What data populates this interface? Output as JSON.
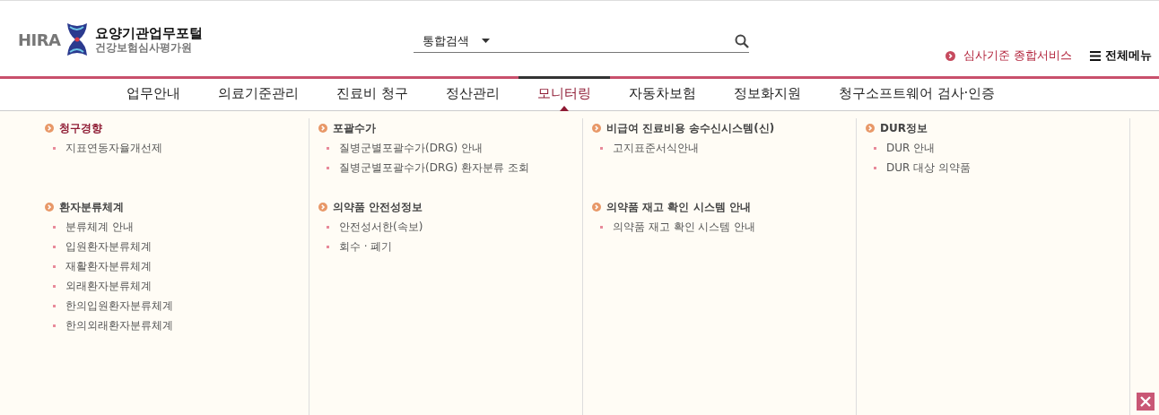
{
  "logo": {
    "mark": "HIRA",
    "title": "요양기관업무포털",
    "subtitle": "건강보험심사평가원"
  },
  "search": {
    "scope": "통합검색"
  },
  "links": [
    {
      "kind": "service",
      "label": "심사기준 종합서비스"
    },
    {
      "kind": "menu",
      "label": "전체메뉴"
    }
  ],
  "nav": [
    {
      "label": "업무안내",
      "selected": false
    },
    {
      "label": "의료기준관리",
      "selected": false
    },
    {
      "label": "진료비 청구",
      "selected": false
    },
    {
      "label": "정산관리",
      "selected": false
    },
    {
      "label": "모니터링",
      "selected": true
    },
    {
      "label": "자동차보험",
      "selected": false
    },
    {
      "label": "정보화지원",
      "selected": false
    },
    {
      "label": "청구소프트웨어 검사·인증",
      "selected": false
    }
  ],
  "columns": [
    {
      "sections": [
        {
          "title": "청구경향",
          "selected": true,
          "items": [
            "지표연동자율개선제"
          ]
        },
        {
          "title": "환자분류체계",
          "selected": false,
          "items": [
            "분류체계 안내",
            "입원환자분류체계",
            "재활환자분류체계",
            "외래환자분류체계",
            "한의입원환자분류체계",
            "한의외래환자분류체계"
          ]
        }
      ]
    },
    {
      "sections": [
        {
          "title": "포괄수가",
          "selected": false,
          "items": [
            "질병군별포괄수가(DRG) 안내",
            "질병군별포괄수가(DRG) 환자분류 조회"
          ]
        },
        {
          "title": "의약품 안전성정보",
          "selected": false,
          "items": [
            "안전성서한(속보)",
            "회수 · 폐기"
          ]
        }
      ]
    },
    {
      "sections": [
        {
          "title": "비급여 진료비용 송수신시스템(신)",
          "selected": false,
          "items": [
            "고지표준서식안내"
          ]
        },
        {
          "title": "의약품 재고 확인 시스템 안내",
          "selected": false,
          "items": [
            "의약품 재고 확인 시스템 안내"
          ]
        }
      ]
    },
    {
      "sections": [
        {
          "title": "DUR정보",
          "selected": false,
          "items": [
            "DUR 안내",
            "DUR 대상 의약품"
          ]
        }
      ]
    }
  ]
}
